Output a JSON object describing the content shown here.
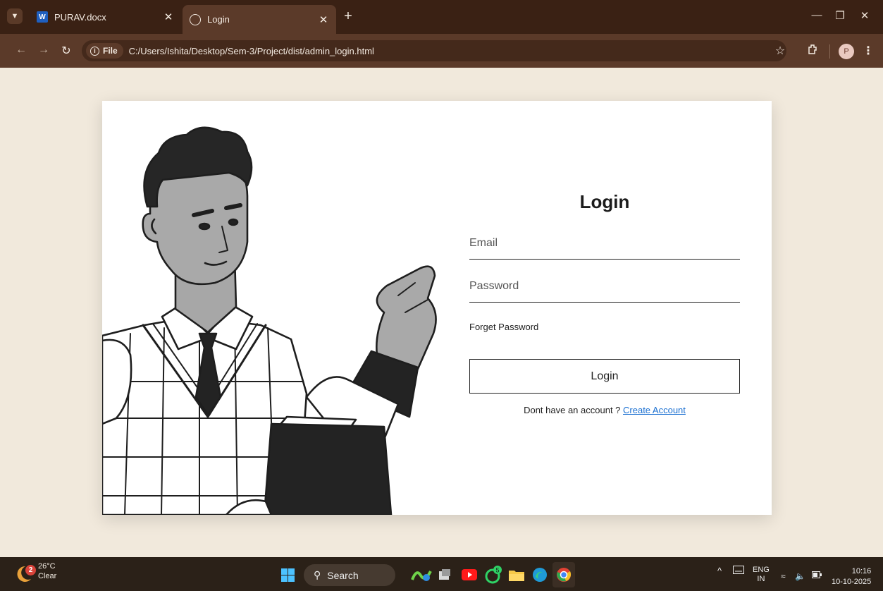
{
  "browser": {
    "tabs": [
      {
        "title": "PURAV.docx",
        "favicon": "word-icon"
      },
      {
        "title": "Login",
        "favicon": "globe-icon"
      }
    ],
    "address": {
      "chip_label": "File",
      "url": "C:/Users/Ishita/Desktop/Sem-3/Project/dist/admin_login.html"
    },
    "profile_initial": "P"
  },
  "login": {
    "heading": "Login",
    "email_placeholder": "Email",
    "password_placeholder": "Password",
    "forgot_label": "Forget Password",
    "submit_label": "Login",
    "signup_prompt": "Dont have an account ? ",
    "signup_link": "Create Account"
  },
  "taskbar": {
    "weather": {
      "badge": "2",
      "temp": "26°C",
      "condition": "Clear"
    },
    "search_label": "Search",
    "whatsapp_badge": "5",
    "language": {
      "line1": "ENG",
      "line2": "IN"
    },
    "time": "10:16",
    "date": "10-10-2025"
  },
  "colors": {
    "page_bg": "#f1e9dc",
    "tabbar_bg": "#3a2114",
    "toolbar_bg": "#5b3a29",
    "link": "#1a6fd1",
    "taskbar_bg": "#2b2118"
  }
}
